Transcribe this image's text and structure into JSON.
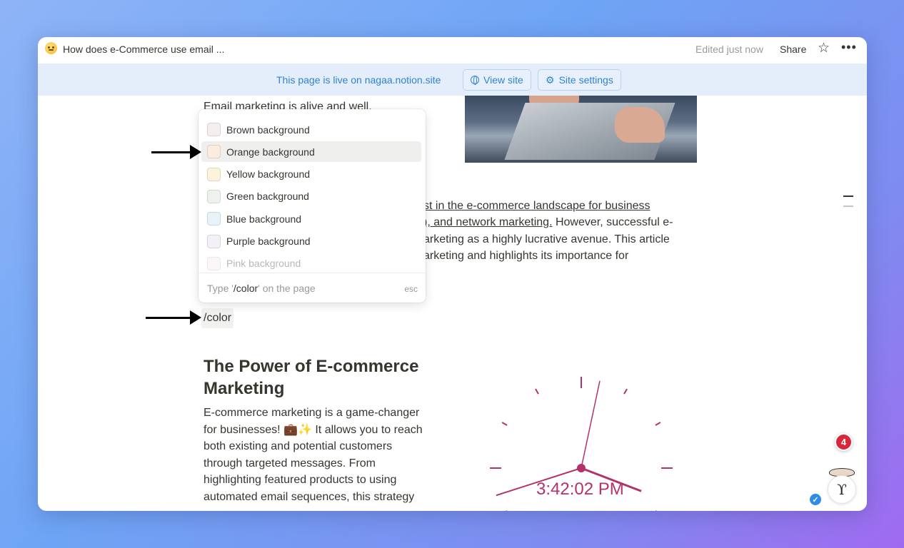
{
  "topbar": {
    "page_title": "How does e-Commerce use email ...",
    "edited": "Edited just now",
    "share": "Share",
    "star_icon": "star-icon",
    "more_icon": "more-icon"
  },
  "banner": {
    "text": "This page is live on nagaa.notion.site",
    "view_site": "View site",
    "site_settings": "Site settings"
  },
  "content": {
    "intro_line": "Email marketing is alive and well.",
    "p1_line1": "st in the e-commerce landscape for business ",
    "p1_line2a": "), and network marketing.",
    "p1_line2b": " However, successful e-",
    "p1_line3": "arketing as a highly lucrative avenue. This article",
    "p1_line4": "arketing and highlights its importance for",
    "slash_command": "/color",
    "heading": "The Power of E-commerce Marketing",
    "para_1": "E-commerce marketing is a game-changer for businesses! ",
    "para_emoji": "💼✨",
    "para_2": " It allows you to reach both existing and potential customers through targeted messages. From highlighting featured products to using automated email sequences, this strategy"
  },
  "color_menu": {
    "items": [
      {
        "label": "Brown background",
        "color": "#f4eeee"
      },
      {
        "label": "Orange background",
        "color": "#fbecdd"
      },
      {
        "label": "Yellow background",
        "color": "#fbf3db"
      },
      {
        "label": "Green background",
        "color": "#edf3ec"
      },
      {
        "label": "Blue background",
        "color": "#e7f3f8"
      },
      {
        "label": "Purple background",
        "color": "#f4f0f7"
      },
      {
        "label": "Pink background",
        "color": "#f9eef3"
      }
    ],
    "active_item": "Orange background",
    "hint_prefix": "Type '",
    "hint_command": "/color",
    "hint_suffix": "' on the page",
    "esc": "esc"
  },
  "clock": {
    "time": "3:42:02 PM",
    "color": "#b3326c"
  },
  "notification_count": "4",
  "colors": {
    "banner_bg": "#e3eefa",
    "banner_text": "#2f82d6",
    "text": "#37352f"
  }
}
